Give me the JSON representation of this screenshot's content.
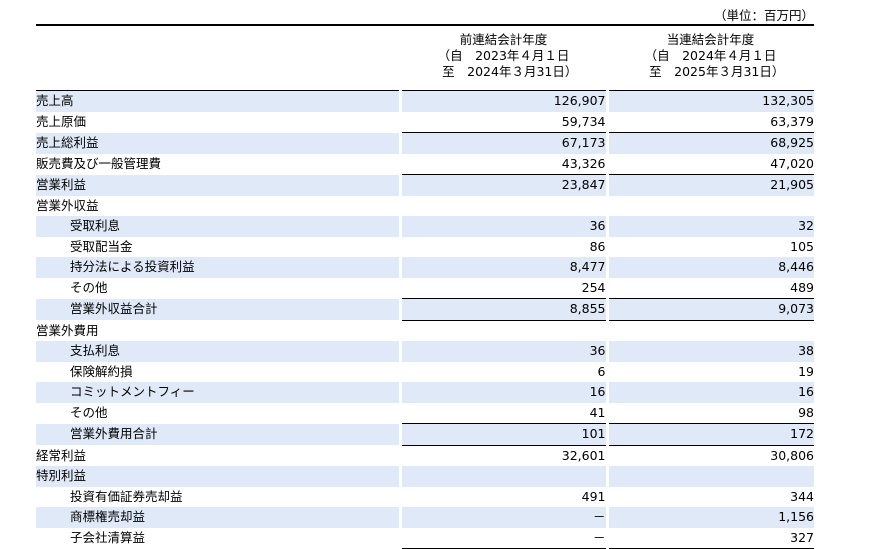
{
  "unit_label": "（単位：百万円）",
  "columns": {
    "prev": {
      "title": "前連結会計年度",
      "from": "（自　2023年４月１日",
      "to": "　至　2024年３月31日）"
    },
    "cur": {
      "title": "当連結会計年度",
      "from": "（自　2024年４月１日",
      "to": "　至　2025年３月31日）"
    }
  },
  "rows": [
    {
      "label": "売上高",
      "prev": "126,907",
      "cur": "132,305"
    },
    {
      "label": "売上原価",
      "prev": "59,734",
      "cur": "63,379"
    },
    {
      "label": "売上総利益",
      "prev": "67,173",
      "cur": "68,925"
    },
    {
      "label": "販売費及び一般管理費",
      "prev": "43,326",
      "cur": "47,020"
    },
    {
      "label": "営業利益",
      "prev": "23,847",
      "cur": "21,905"
    },
    {
      "label": "営業外収益",
      "prev": "",
      "cur": ""
    },
    {
      "label": "受取利息",
      "prev": "36",
      "cur": "32"
    },
    {
      "label": "受取配当金",
      "prev": "86",
      "cur": "105"
    },
    {
      "label": "持分法による投資利益",
      "prev": "8,477",
      "cur": "8,446"
    },
    {
      "label": "その他",
      "prev": "254",
      "cur": "489"
    },
    {
      "label": "営業外収益合計",
      "prev": "8,855",
      "cur": "9,073"
    },
    {
      "label": "営業外費用",
      "prev": "",
      "cur": ""
    },
    {
      "label": "支払利息",
      "prev": "36",
      "cur": "38"
    },
    {
      "label": "保険解約損",
      "prev": "6",
      "cur": "19"
    },
    {
      "label": "コミットメントフィー",
      "prev": "16",
      "cur": "16"
    },
    {
      "label": "その他",
      "prev": "41",
      "cur": "98"
    },
    {
      "label": "営業外費用合計",
      "prev": "101",
      "cur": "172"
    },
    {
      "label": "経常利益",
      "prev": "32,601",
      "cur": "30,806"
    },
    {
      "label": "特別利益",
      "prev": "",
      "cur": ""
    },
    {
      "label": "投資有価証券売却益",
      "prev": "491",
      "cur": "344"
    },
    {
      "label": "商標権売却益",
      "prev": "－",
      "cur": "1,156"
    },
    {
      "label": "子会社清算益",
      "prev": "－",
      "cur": "327"
    }
  ]
}
